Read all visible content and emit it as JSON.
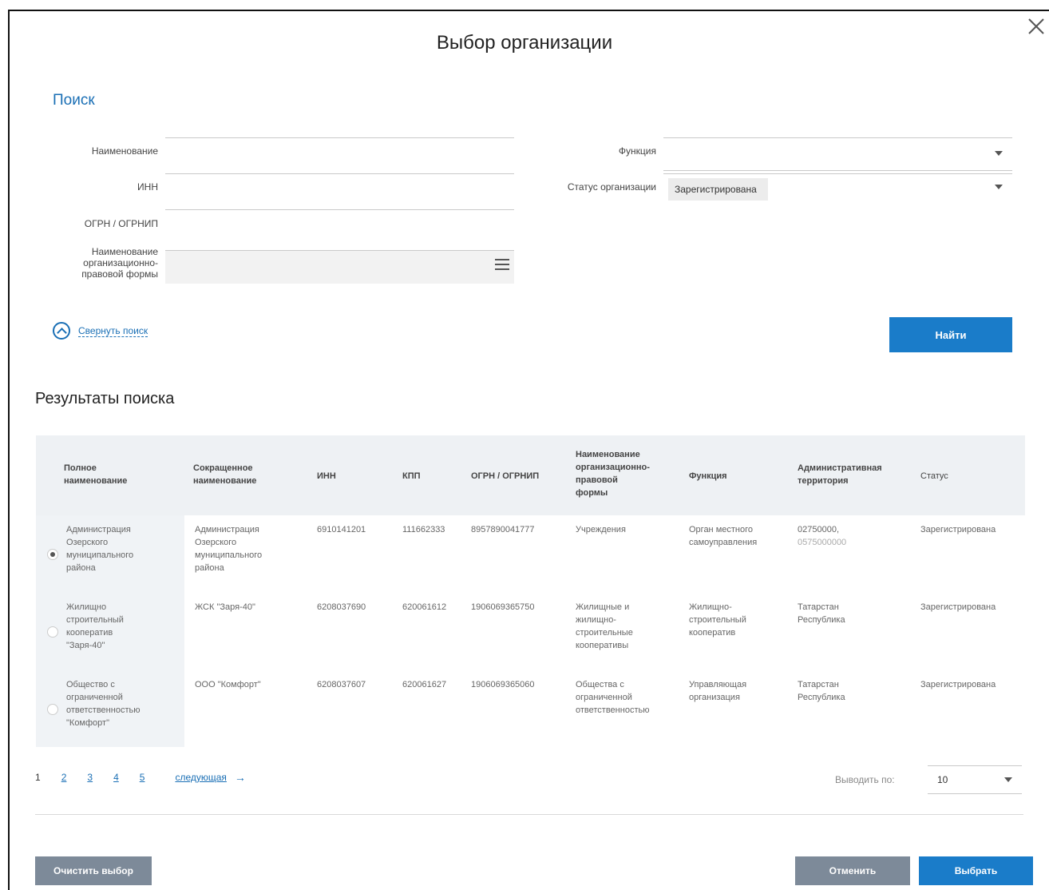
{
  "modal": {
    "title": "Выбор организации"
  },
  "search": {
    "section_title": "Поиск",
    "name_label": "Наименование",
    "name_value": "",
    "inn_label": "ИНН",
    "inn_value": "",
    "ogrn_label": "ОГРН / ОГРНИП",
    "ogrn_value": "",
    "legal_form_label_lines": [
      "Наименование",
      "организационно-",
      "правовой формы"
    ],
    "function_label": "Функция",
    "function_value": "",
    "status_label": "Статус организации",
    "status_value": "Зарегистрирована",
    "collapse_label": "Свернуть поиск",
    "find_button": "Найти"
  },
  "results": {
    "title": "Результаты поиска",
    "columns": [
      [
        "Полное",
        "наименование"
      ],
      [
        "Сокращенное",
        "наименование"
      ],
      [
        "ИНН"
      ],
      [
        "КПП"
      ],
      [
        "ОГРН / ОГРНИП"
      ],
      [
        "Наименование",
        "организационно-",
        "правовой",
        "формы"
      ],
      [
        "Функция"
      ],
      [
        "Административная",
        "территория"
      ],
      [
        "Статус"
      ]
    ],
    "rows": [
      {
        "selected": true,
        "full_name": [
          "Администрация",
          "Озерского",
          "муниципального",
          "района"
        ],
        "short_name": [
          "Администрация",
          "Озерского",
          "муниципального",
          "района"
        ],
        "inn": "6910141201",
        "kpp": "111662333",
        "ogrn": "8957890041777",
        "legal_form": [
          "Учреждения"
        ],
        "function": [
          "Орган местного",
          "самоуправления"
        ],
        "territory": [
          "02750000,",
          "0575000000"
        ],
        "status": "Зарегистрирована"
      },
      {
        "selected": false,
        "full_name": [
          "Жилищно",
          "строительный",
          "кооператив",
          "\"Заря-40\""
        ],
        "short_name": [
          "ЖСК \"Заря-40\""
        ],
        "inn": "6208037690",
        "kpp": "620061612",
        "ogrn": "1906069365750",
        "legal_form": [
          "Жилищные и",
          "жилищно-",
          "строительные",
          "кооперативы"
        ],
        "function": [
          "Жилищно-",
          "строительный",
          "кооператив"
        ],
        "territory": [
          "Татарстан",
          "Республика"
        ],
        "status": "Зарегистрирована"
      },
      {
        "selected": false,
        "full_name": [
          "Общество с",
          "ограниченной",
          "ответственностью",
          "\"Комфорт\""
        ],
        "short_name": [
          "ООО \"Комфорт\""
        ],
        "inn": "6208037607",
        "kpp": "620061627",
        "ogrn": "1906069365060",
        "legal_form": [
          "Общества с",
          "ограниченной",
          "ответственностью"
        ],
        "function": [
          "Управляющая",
          "организация"
        ],
        "territory": [
          "Татарстан",
          "Республика"
        ],
        "status": "Зарегистрирована"
      }
    ]
  },
  "pagination": {
    "pages": [
      "1",
      "2",
      "3",
      "4",
      "5"
    ],
    "current": "1",
    "next_label": "следующая",
    "per_page_label": "Выводить по:",
    "per_page_value": "10"
  },
  "footer": {
    "clear_button": "Очистить выбор",
    "cancel_button": "Отменить",
    "select_button": "Выбрать"
  }
}
